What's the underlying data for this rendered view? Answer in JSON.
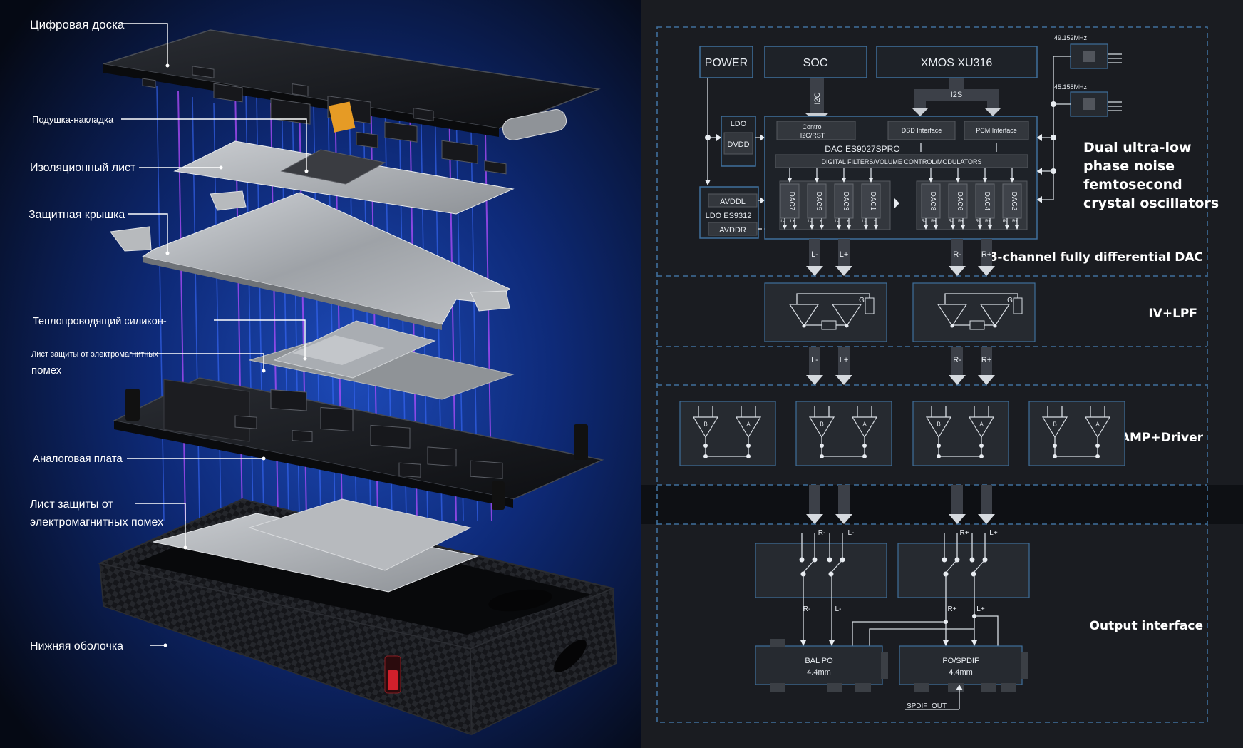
{
  "exploded": {
    "labels": [
      "Цифровая доска",
      "Подушка-накладка",
      "Изоляционный лист",
      "Защитная крышка",
      "Теплопроводящий силикон-",
      "Лист защиты от электромагнитных",
      "помех",
      "Аналоговая плата",
      "Лист защиты от",
      "электромагнитных помех",
      "Нижняя оболочка"
    ]
  },
  "diagram": {
    "top_blocks": {
      "power": "POWER",
      "soc": "SOC",
      "xmos": "XMOS XU316"
    },
    "bus": {
      "i2c": "I2C",
      "i2s": "I2S"
    },
    "ldo_left": {
      "ldo": "LDO",
      "dvdd": "DVDD"
    },
    "ldo_es": {
      "avddl": "AVDDL",
      "name": "LDO ES9312",
      "avddr": "AVDDR"
    },
    "dac": {
      "control": "Control",
      "control2": "I2C/RST",
      "dsd": "DSD Interface",
      "pcm": "PCM Interface",
      "name": "DAC ES9027SPRO",
      "filters": "DIGITAL FILTERS/VOLUME CONTROL/MODULATORS",
      "channels_left": [
        "DAC7",
        "DAC5",
        "DAC3",
        "DAC1"
      ],
      "channels_right": [
        "DAC8",
        "DAC6",
        "DAC4",
        "DAC2"
      ],
      "pins_left": [
        "L-",
        "L+",
        "L-",
        "L+",
        "L-",
        "L+",
        "L-",
        "L+"
      ],
      "pins_right": [
        "R-",
        "R+",
        "R-",
        "R+",
        "R-",
        "R+",
        "R-",
        "R+"
      ]
    },
    "oscillators": {
      "freq1": "49.152MHz",
      "freq2": "45.158MHz"
    },
    "osc_text": [
      "Dual ultra-low",
      "phase noise",
      "femtosecond",
      "crystal oscillators"
    ],
    "sections": {
      "dac": "8-channel fully differential DAC",
      "ivlpf": "IV+LPF",
      "amp": "AMP+Driver",
      "output": "Output interface"
    },
    "signals": {
      "dac_out": [
        "L-",
        "L+",
        "R-",
        "R+"
      ],
      "iv_out": [
        "L-",
        "L+",
        "R-",
        "R+"
      ],
      "amp_out": [
        "R-",
        "L-",
        "R+",
        "L+"
      ],
      "sw_out": [
        "R-",
        "L-",
        "R+",
        "L+"
      ]
    },
    "gain_label": "G",
    "amp_labels": [
      "B",
      "A"
    ],
    "outputs": {
      "bal_po": "BAL PO",
      "bal_size": "4.4mm",
      "po_spdif": "PO/SPDIF",
      "po_size": "4.4mm",
      "spdif_out": "SPDIF_OUT"
    }
  },
  "colors": {
    "background": "#0b0d12",
    "block_stroke": "#3f6f9c",
    "glow_blue": "#3a6cff",
    "glow_purple": "#b34dff"
  }
}
